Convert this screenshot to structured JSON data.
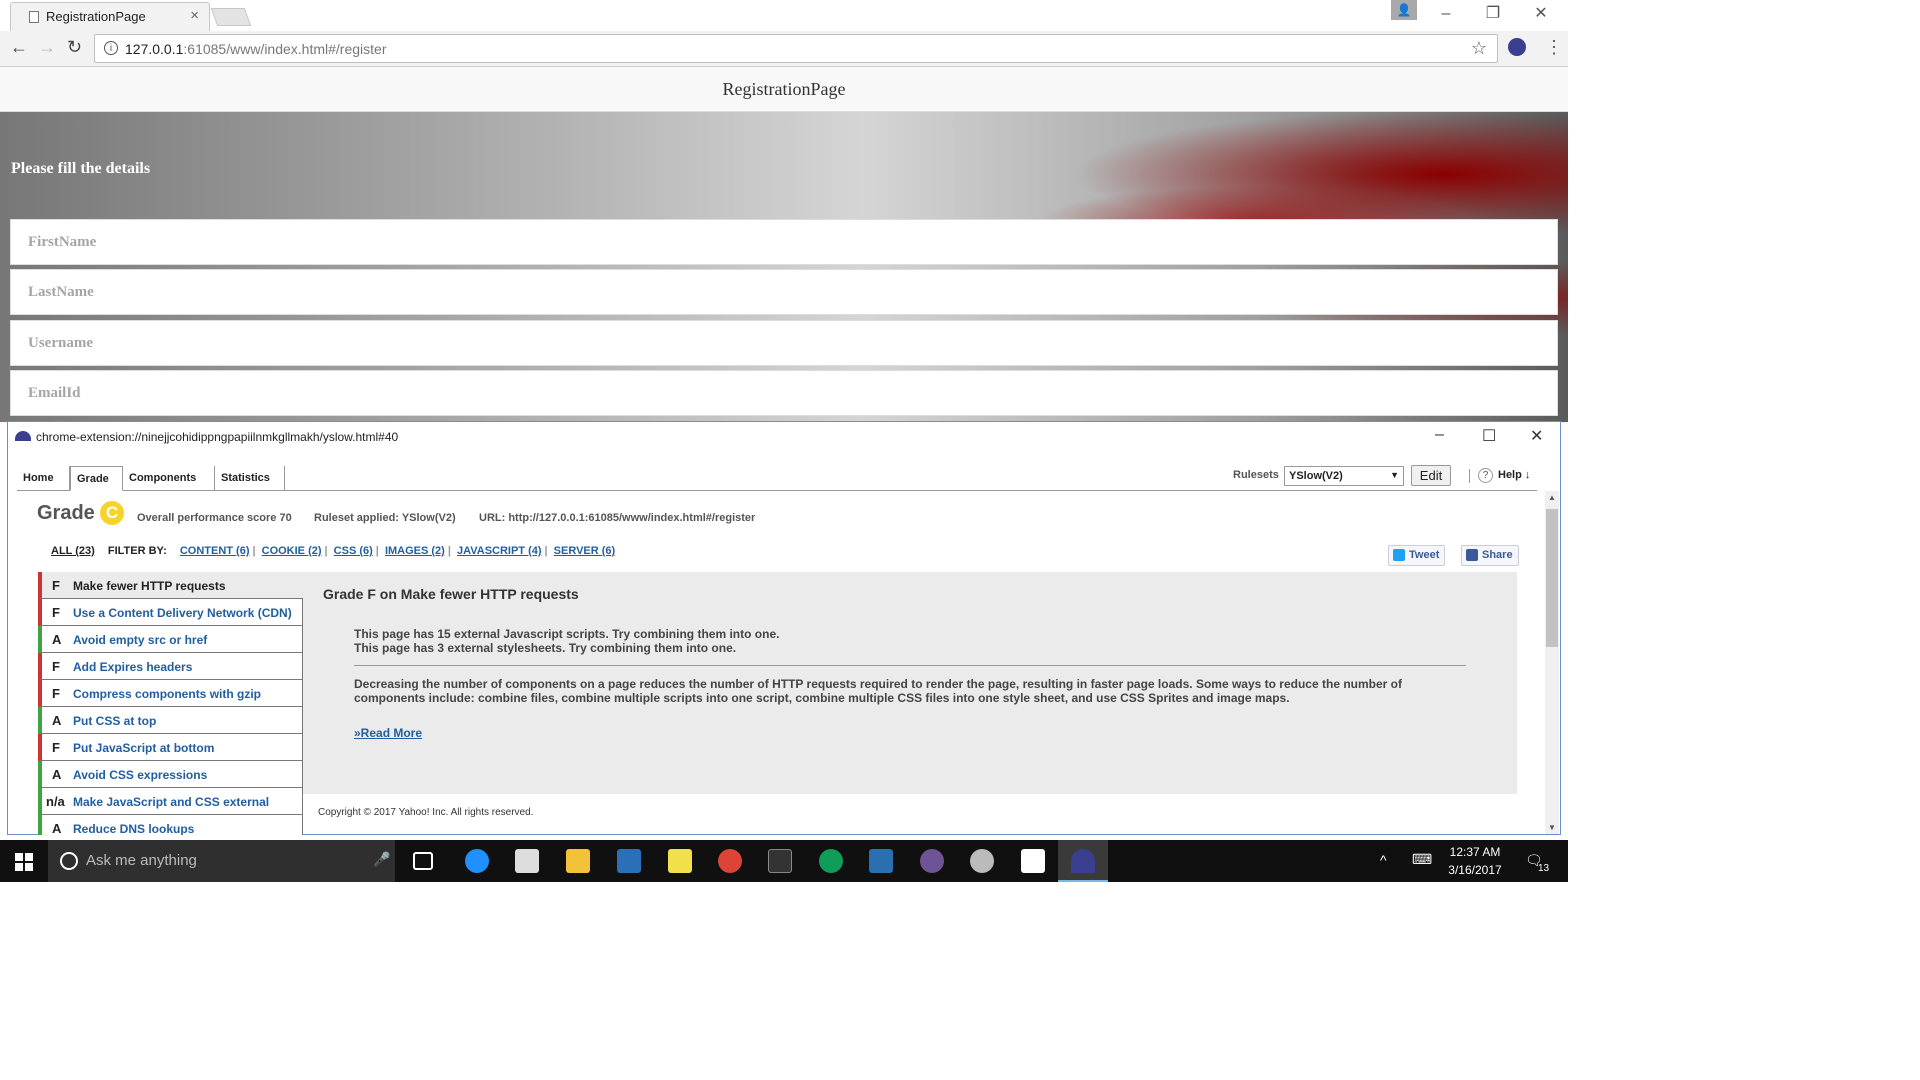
{
  "browser": {
    "tab_title": "RegistrationPage",
    "tab_close": "×",
    "url_host": "127.0.0.1",
    "url_rest": ":61085/www/index.html#/register",
    "window_controls": {
      "minimize": "–",
      "restore": "❐",
      "close": "✕"
    }
  },
  "page": {
    "header_title": "RegistrationPage",
    "form_title": "Please fill the details",
    "fields": {
      "firstname": "FirstName",
      "lastname": "LastName",
      "username": "Username",
      "email": "EmailId"
    }
  },
  "yslow": {
    "window_title": "chrome-extension://ninejjcohidippngpapiilnmkgllmakh/yslow.html#40",
    "tabs": [
      "Home",
      "Grade",
      "Components",
      "Statistics"
    ],
    "active_tab": "Grade",
    "rulesets_label": "Rulesets",
    "ruleset_value": "YSlow(V2)",
    "edit_label": "Edit",
    "help_label": "Help ↓",
    "grade_label": "Grade",
    "grade_letter": "C",
    "overall_score": "Overall performance score 70",
    "ruleset_applied": "Ruleset applied: YSlow(V2)",
    "url_info": "URL: http://127.0.0.1:61085/www/index.html#/register",
    "filter": {
      "all": "ALL (23)",
      "by_label": "FILTER BY:",
      "content": "CONTENT (6)",
      "cookie": "COOKIE (2)",
      "css": "CSS (6)",
      "images": "IMAGES (2)",
      "javascript": "JAVASCRIPT (4)",
      "server": "SERVER (6)"
    },
    "tweet_label": "Tweet",
    "share_label": "Share",
    "rules": [
      {
        "grade": "F",
        "name": "Make fewer HTTP requests"
      },
      {
        "grade": "F",
        "name": "Use a Content Delivery Network (CDN)"
      },
      {
        "grade": "A",
        "name": "Avoid empty src or href"
      },
      {
        "grade": "F",
        "name": "Add Expires headers"
      },
      {
        "grade": "F",
        "name": "Compress components with gzip"
      },
      {
        "grade": "A",
        "name": "Put CSS at top"
      },
      {
        "grade": "F",
        "name": "Put JavaScript at bottom"
      },
      {
        "grade": "A",
        "name": "Avoid CSS expressions"
      },
      {
        "grade": "n/a",
        "name": "Make JavaScript and CSS external"
      },
      {
        "grade": "A",
        "name": "Reduce DNS lookups"
      }
    ],
    "detail": {
      "heading": "Grade F on Make fewer HTTP requests",
      "line1": "This page has 15 external Javascript scripts. Try combining them into one.",
      "line2": "This page has 3 external stylesheets. Try combining them into one.",
      "description": "Decreasing the number of components on a page reduces the number of HTTP requests required to render the page, resulting in faster page loads. Some ways to reduce the number of components include: combine files, combine multiple scripts into one script, combine multiple CSS files into one style sheet, and use CSS Sprites and image maps.",
      "read_more": "»Read More"
    },
    "copyright": "Copyright © 2017 Yahoo! Inc. All rights reserved."
  },
  "taskbar": {
    "search_placeholder": "Ask me anything",
    "time": "12:37 AM",
    "date": "3/16/2017",
    "notifications": "13"
  }
}
